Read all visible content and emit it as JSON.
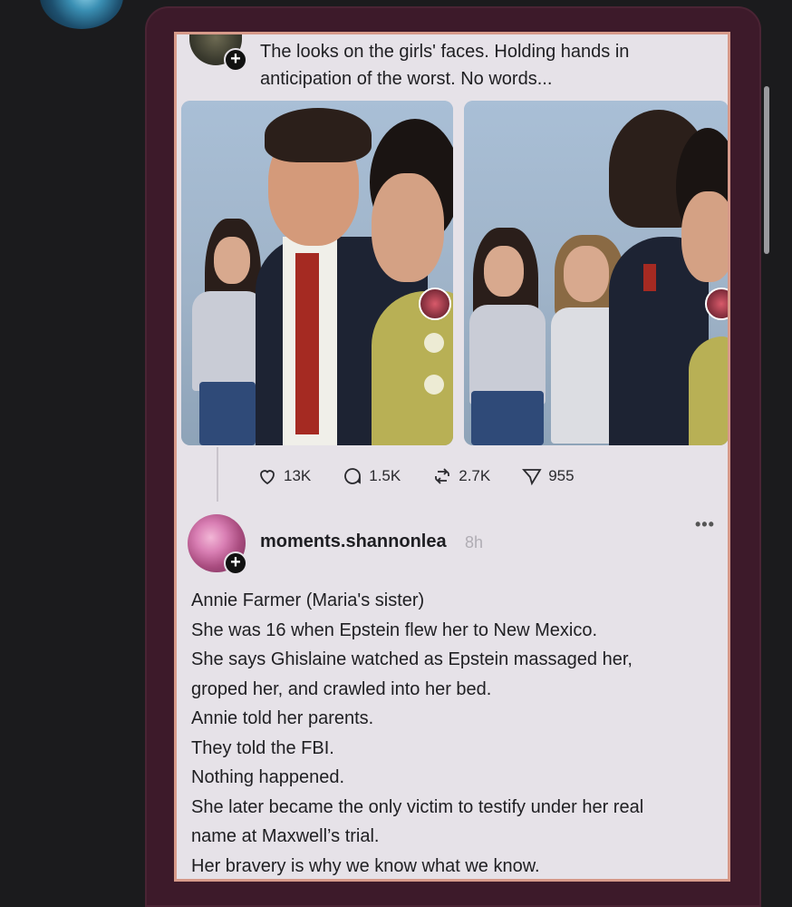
{
  "post1": {
    "text": "The looks on the girls' faces. Holding hands in anticipation of the worst. No words...",
    "stats": {
      "likes": "13K",
      "comments": "1.5K",
      "reposts": "2.7K",
      "shares": "955"
    }
  },
  "post2": {
    "username": "moments.shannonlea",
    "time": "8h",
    "more": "•••",
    "lines": [
      "Annie Farmer (Maria's sister)",
      "She was 16 when Epstein flew her to New Mexico.",
      "She says Ghislaine watched as Epstein massaged her,",
      "groped her, and crawled into her bed.",
      "Annie told her parents.",
      "They told the FBI.",
      "Nothing happened.",
      "She later became the only victim to testify under her real",
      "name at Maxwell’s trial.",
      "Her bravery is why we know what we know."
    ]
  },
  "icons": {
    "like": "heart-icon",
    "comment": "comment-icon",
    "repost": "repost-icon",
    "share": "send-icon",
    "follow": "plus-icon"
  }
}
